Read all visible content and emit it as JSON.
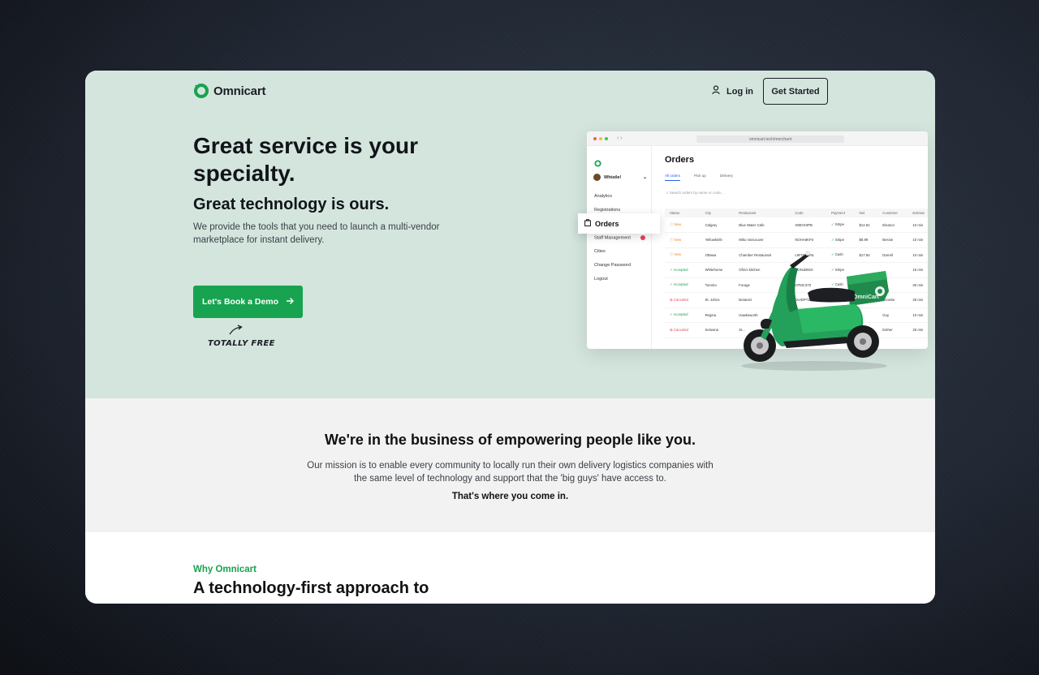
{
  "brand": {
    "name": "Omnicart",
    "accent": "#17a34f",
    "hero_bg": "#d4e5de"
  },
  "nav": {
    "login_label": "Log in",
    "get_started_label": "Get Started"
  },
  "hero": {
    "title": "Great service is your specialty.",
    "subtitle": "Great technology is ours.",
    "description": "We provide the tools that you need to launch a multi-vendor marketplace for instant delivery.",
    "cta_label": "Let's Book a Demo",
    "cta_note": "TOTALLY FREE"
  },
  "dashboard": {
    "url": "omnicart.tech/merchant",
    "title": "Orders",
    "user": "Whistle!",
    "sidebar": [
      "Analytics",
      "Registrations",
      "Orders",
      "Staff Management",
      "Cities",
      "Change Password",
      "Logout"
    ],
    "tabs": [
      "All orders",
      "Pick up",
      "Delivery"
    ],
    "search_placeholder": "Search orders by name or code...",
    "columns": [
      "Status",
      "City",
      "Restaurant",
      "Code",
      "Payment",
      "Net",
      "Customer",
      "Estimat"
    ],
    "rows": [
      [
        "New",
        "Calgary",
        "Blue Water Cafe",
        "X8EOHIPB",
        "Stripe",
        "$14.81",
        "Eleanor",
        "10 min"
      ],
      [
        "New",
        "Yellowknife",
        "Miku Vancouver",
        "NOHA8KF6",
        "Stripe",
        "$8.99",
        "Bessie",
        "10 min"
      ],
      [
        "New",
        "Ottawa",
        "Chamber Restaurant",
        "L5FO9PV9L",
        "Cash",
        "$17.84",
        "Darrell",
        "10 min"
      ],
      [
        "Accepted",
        "Whitehorse",
        "Ofra's kitchen",
        "DON1B92X",
        "Stripe",
        "",
        "",
        "15 min"
      ],
      [
        "Accepted",
        "Toronto",
        "Forage",
        "CPMC370",
        "Cash",
        "",
        "",
        "30 min"
      ],
      [
        "Canceled",
        "St. Johns",
        "Botanist",
        "DUIDPT13A",
        "",
        "",
        "Annette",
        "25 min"
      ],
      [
        "Accepted",
        "Regina",
        "Hawksworth",
        "X8EOHIPB",
        "",
        "",
        "Guy",
        "10 min"
      ],
      [
        "Canceled",
        "Kelowna",
        "St...",
        "NOHA8KF6",
        "",
        "",
        "Esther",
        "25 min"
      ]
    ],
    "scooter_label": "OmniCart"
  },
  "mission": {
    "title": "We're in the business of empowering people like you.",
    "text_line1": "Our mission is to enable every community to locally run their own delivery logistics companies with",
    "text_line2": "the same level of technology and support that the 'big guys' have access to.",
    "closing": "That's where you come in."
  },
  "why": {
    "label": "Why Omnicart",
    "title": "A technology-first approach to"
  }
}
